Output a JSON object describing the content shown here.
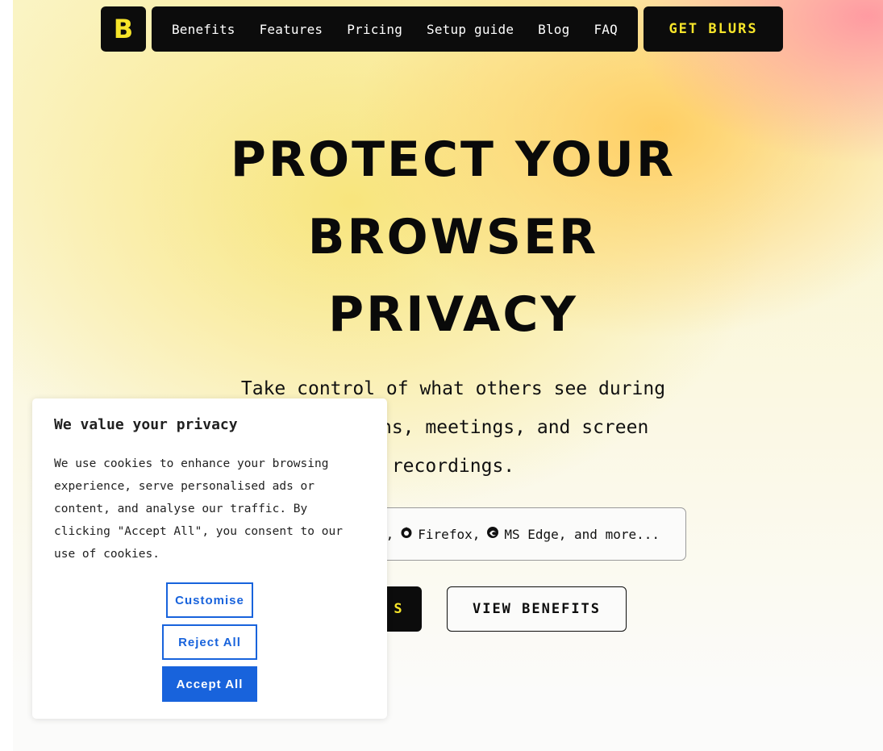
{
  "nav": {
    "logo_letter": "B",
    "links": [
      "Benefits",
      "Features",
      "Pricing",
      "Setup guide",
      "Blog",
      "FAQ"
    ],
    "cta_label": "GET BLURS"
  },
  "hero": {
    "headline": "PROTECT YOUR BROWSER PRIVACY",
    "subtitle": "Take control of what others see during presentations, meetings, and screen recordings.",
    "browsers_text_1": ",",
    "browser_firefox": "Firefox,",
    "browser_edge": "MS Edge, and more...",
    "primary_cta": "S",
    "secondary_cta": "VIEW BENEFITS"
  },
  "cookie_banner": {
    "title": "We value your privacy",
    "body": "We use cookies to enhance your browsing experience, serve personalised ads or content, and analyse our traffic. By clicking \"Accept All\", you consent to our use of cookies.",
    "customise_label": "Customise",
    "reject_label": "Reject All",
    "accept_label": "Accept All"
  },
  "colors": {
    "brand_yellow": "#f7e52a",
    "dark": "#0c0c0c",
    "cookie_blue": "#1863dc"
  },
  "icons": {
    "firefox": "firefox-icon",
    "edge": "edge-icon"
  }
}
